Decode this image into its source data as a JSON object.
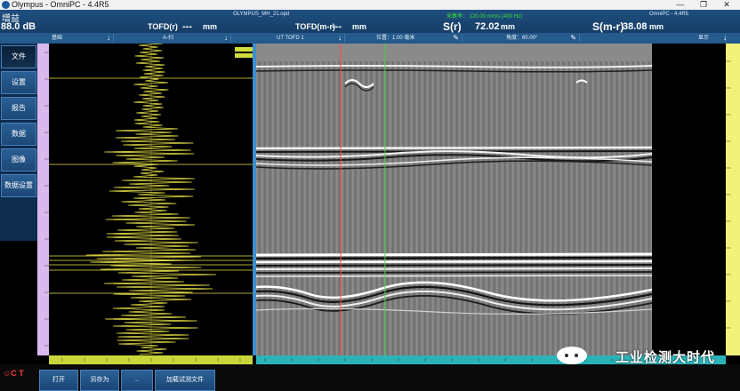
{
  "window": {
    "title": "Olympus - OmniPC - 4.4R5",
    "controls": [
      "—",
      "❐",
      "✕"
    ]
  },
  "header": {
    "gain_label": "增益",
    "gain_value": "88.0 dB",
    "file_name": "OLYMPUS_MH_21.opd",
    "status_green": "采集率： 120.00 mm/s (400 Hz)",
    "app_version": "OmniPC - 4.4R5",
    "readings": [
      {
        "label": "TOFD(r)",
        "value": "---",
        "unit": "mm"
      },
      {
        "label": "TOFD(m-r)",
        "value": "---",
        "unit": "mm"
      },
      {
        "label": "S(r)",
        "value": "72.02",
        "unit": "mm"
      },
      {
        "label": "S(m-r)",
        "value": "38.08",
        "unit": "mm"
      }
    ]
  },
  "toolbar2": {
    "cells": [
      {
        "label": "基础",
        "icon": "↓"
      },
      {
        "label": "A-扫",
        "icon": "↓"
      },
      {
        "label": "UT TOFD 1",
        "icon": "↓"
      },
      {
        "label": "位置：1.00 毫米",
        "icon": "✎"
      },
      {
        "label": "角度：60.00°",
        "icon": "✎"
      },
      {
        "label": "显示",
        "icon": "↓"
      }
    ]
  },
  "sidenav": {
    "items": [
      "文件",
      "设置",
      "报告",
      "数据",
      "图像",
      "数据设置"
    ]
  },
  "bottombar": {
    "buttons": [
      "打开",
      "另存为",
      "..",
      "加载试测文件"
    ],
    "watermark": "工业检测大时代",
    "status_icons": "☺C T"
  },
  "colors": {
    "accent": "#1f4f80",
    "ascan": "#e8e048",
    "status_green": "#38e038",
    "cursor_red": "#ff4a4a",
    "cursor_green": "#44d044"
  }
}
